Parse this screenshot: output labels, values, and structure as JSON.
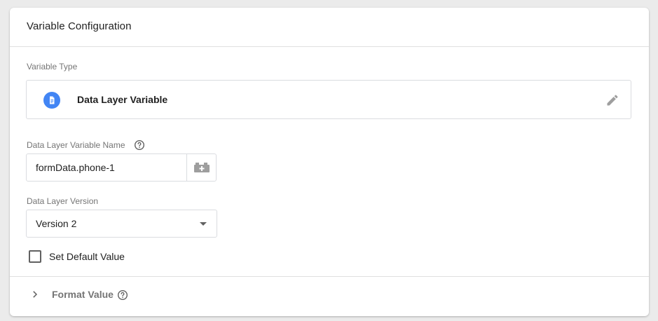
{
  "card": {
    "title": "Variable Configuration"
  },
  "variable_type": {
    "label": "Variable Type",
    "name": "Data Layer Variable",
    "icon": "document-icon",
    "icon_color": "#4285f4"
  },
  "variable_name": {
    "label": "Data Layer Variable Name",
    "value": "formData.phone-1",
    "picker_icon": "variable-brick-icon"
  },
  "version": {
    "label": "Data Layer Version",
    "selected": "Version 2"
  },
  "default_value": {
    "label": "Set Default Value",
    "checked": false
  },
  "format_value": {
    "label": "Format Value",
    "expanded": false
  }
}
